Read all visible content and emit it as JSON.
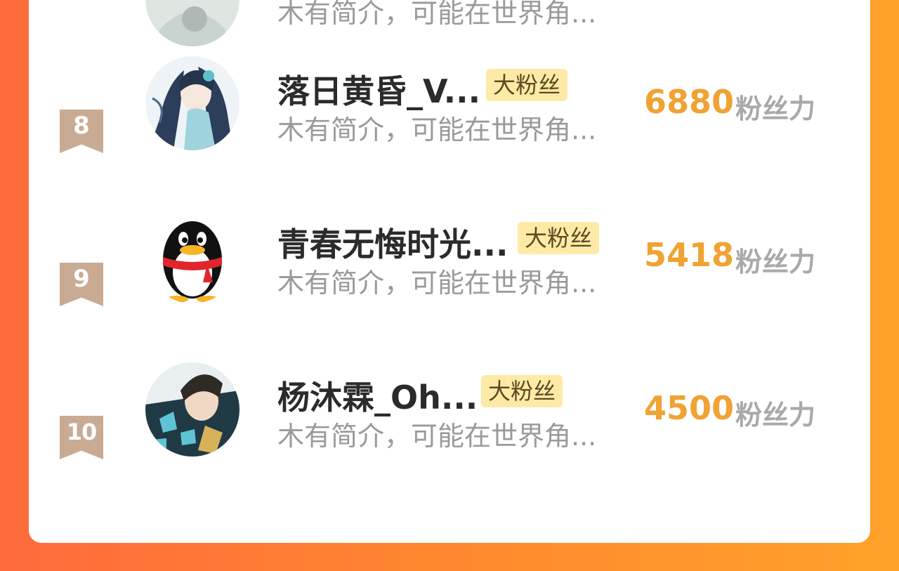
{
  "rows": [
    {
      "rank": "",
      "name": "",
      "badge": "",
      "intro": "木有简介，可能在世界角...",
      "score": "",
      "unit": ""
    },
    {
      "rank": "8",
      "name": "落日黄昏_V...",
      "badge": "大粉丝",
      "intro": "木有简介，可能在世界角...",
      "score": "6880",
      "unit": "粉丝力"
    },
    {
      "rank": "9",
      "name": "青春无悔时光...",
      "badge": "大粉丝",
      "intro": "木有简介，可能在世界角...",
      "score": "5418",
      "unit": "粉丝力"
    },
    {
      "rank": "10",
      "name": "杨沐霖_Oh...",
      "badge": "大粉丝",
      "intro": "木有简介，可能在世界角...",
      "score": "4500",
      "unit": "粉丝力"
    }
  ],
  "colors": {
    "accent_score": "#f0a233",
    "badge_bg": "#fdeaa6",
    "rank_ribbon": "#c9ab93",
    "gradient_left": "#ff6a3c",
    "gradient_right": "#ffa22a"
  },
  "icons": {
    "avatar_8": "anime-girl-avatar",
    "avatar_9": "qq-penguin-avatar",
    "avatar_10": "anime-boy-avatar"
  }
}
